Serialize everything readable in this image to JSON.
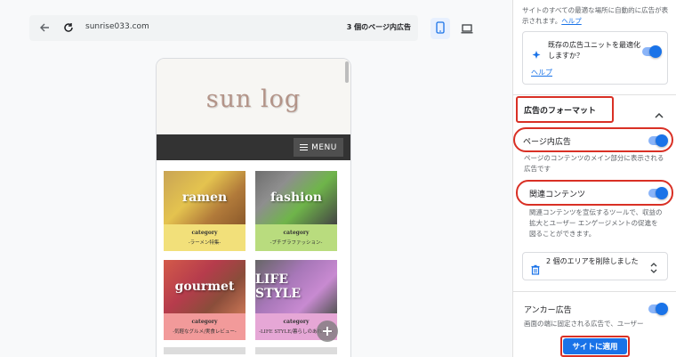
{
  "toolbar": {
    "url": "sunrise033.com",
    "ad_count": "3 個のページ内広告"
  },
  "preview": {
    "logo": "sun log",
    "menu_label": "MENU",
    "cards": [
      {
        "title": "ramen",
        "category": "category",
        "subtitle": "-ラーメン特集-"
      },
      {
        "title": "fashion",
        "category": "category",
        "subtitle": "-プチプラファッション-"
      },
      {
        "title": "gourmet",
        "category": "category",
        "subtitle": "-気軽なグルメ/実食レビュー-"
      },
      {
        "title": "LIFE STYLE",
        "category": "category",
        "subtitle": "-LIFE STYLE/暮らしのあれこれ-"
      }
    ]
  },
  "panel": {
    "top_text": "サイトのすべての最適な場所に自動的に広告が表示されます。",
    "top_help": "ヘルプ",
    "optimize_text": "既存の広告ユニットを最適化しますか？",
    "optimize_help": "ヘルプ",
    "format_title": "広告のフォーマット",
    "in_page_label": "ページ内広告",
    "in_page_desc": "ページのコンテンツのメイン部分に表示される広告です",
    "related_label": "関連コンテンツ",
    "related_desc": "関連コンテンツを宣伝するツールで、収益の拡大とユーザー エンゲージメントの促進を図ることができます。",
    "delete_text": "2 個のエリアを削除しました",
    "anchor_label": "アンカー広告",
    "anchor_desc": "画面の端に固定される広告で、ユーザー",
    "apply_label": "サイトに適用"
  },
  "colors": {
    "accent": "#1a73e8",
    "highlight": "#d93025"
  }
}
